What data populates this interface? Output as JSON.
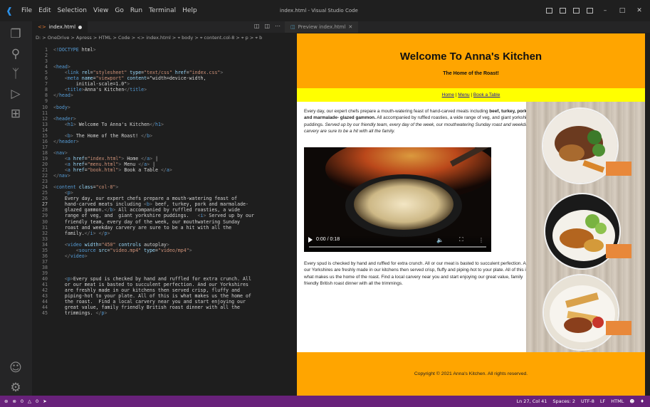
{
  "app": {
    "title": "index.html - Visual Studio Code",
    "logo": "vscode-logo"
  },
  "menu": [
    "File",
    "Edit",
    "Selection",
    "View",
    "Go",
    "Run",
    "Terminal",
    "Help"
  ],
  "activity_icons": [
    "explorer-icon",
    "search-icon",
    "source-control-icon",
    "run-debug-icon",
    "extensions-icon",
    "account-icon",
    "settings-gear-icon"
  ],
  "editor": {
    "tab_label": "index.html",
    "breadcrumb": "D: > OneDrive > Apress > HTML > Code > <> index.html > ⌖ body > ⌖ content.col-8 > ⌖ p > ⌖ b",
    "current_line": 27,
    "lines": [
      {
        "n": "1",
        "t": "<!DOCTYPE html>"
      },
      {
        "n": "2",
        "t": ""
      },
      {
        "n": "3",
        "t": ""
      },
      {
        "n": "4",
        "t": "<head>"
      },
      {
        "n": "5",
        "t": "    <link rel=\"stylesheet\" type=\"text/css\" href=\"index.css\">"
      },
      {
        "n": "6",
        "t": "    <meta name=\"viewport\" content=\"width=device-width,"
      },
      {
        "n": "7",
        "t": "        initial-scale=1.0\">"
      },
      {
        "n": "8",
        "t": "    <title>Anna's Kitchen</title>"
      },
      {
        "n": "8",
        "t": "</head>"
      },
      {
        "n": "9",
        "t": ""
      },
      {
        "n": "10",
        "t": "<body>"
      },
      {
        "n": "11",
        "t": ""
      },
      {
        "n": "12",
        "t": "<header>"
      },
      {
        "n": "13",
        "t": "    <h1> Welcome To Anna's Kitchen</h1>"
      },
      {
        "n": "14",
        "t": ""
      },
      {
        "n": "15",
        "t": "    <b> The Home of the Roast! </b>"
      },
      {
        "n": "16",
        "t": "</header>"
      },
      {
        "n": "17",
        "t": ""
      },
      {
        "n": "18",
        "t": "<nav>"
      },
      {
        "n": "19",
        "t": "    <a href=\"index.html\"> Home </a> |"
      },
      {
        "n": "20",
        "t": "    <a href=\"menu.html\"> Menu </a> |"
      },
      {
        "n": "21",
        "t": "    <a href=\"book.html\"> Book a Table </a>"
      },
      {
        "n": "22",
        "t": "</nav>"
      },
      {
        "n": "23",
        "t": ""
      },
      {
        "n": "24",
        "t": "<content class=\"col-8\">"
      },
      {
        "n": "25",
        "t": "    <p>"
      },
      {
        "n": "26",
        "t": "    Every day, our expert chefs prepare a mouth-watering feast of"
      },
      {
        "n": "27",
        "t": "    hand-carved meats including <b> beef, turkey, pork and marmalade-"
      },
      {
        "n": "28",
        "t": "    glazed gammon.</b> All accompanied by ruffled roasties, a wide"
      },
      {
        "n": "29",
        "t": "    range of veg, and  giant yorkshire puddings.   <i> Served up by our"
      },
      {
        "n": "30",
        "t": "    friendly team, every day of the week, our mouthwatering Sunday"
      },
      {
        "n": "31",
        "t": "    roast and weekday carvery are sure to be a hit with all the"
      },
      {
        "n": "32",
        "t": "    family.</i> </p>"
      },
      {
        "n": "33",
        "t": ""
      },
      {
        "n": "34",
        "t": "    <video width=\"450\" controls autoplay>"
      },
      {
        "n": "35",
        "t": "        <source src=\"video.mp4\" type=\"video/mp4\">"
      },
      {
        "n": "36",
        "t": "    </video>"
      },
      {
        "n": "37",
        "t": ""
      },
      {
        "n": "38",
        "t": ""
      },
      {
        "n": "39",
        "t": ""
      },
      {
        "n": "40",
        "t": "    <p>Every spud is checked by hand and ruffled for extra crunch. All"
      },
      {
        "n": "41",
        "t": "    or our meat is basted to succulent perfection. And our Yorkshires"
      },
      {
        "n": "42",
        "t": "    are freshly made in our kitchens then served crisp, fluffy and"
      },
      {
        "n": "43",
        "t": "    piping-hot to your plate. All of this is what makes us the home of"
      },
      {
        "n": "44",
        "t": "    the roast.  Find a local carvery near you and start enjoying our"
      },
      {
        "n": "44",
        "t": "    great value, family friendly British roast dinner with all the"
      },
      {
        "n": "45",
        "t": "    trimmings. </p>"
      }
    ]
  },
  "preview": {
    "tab_label": "Preview index.html",
    "site": {
      "h1": "Welcome To Anna's Kitchen",
      "tagline": "The Home of the Roast!",
      "nav": {
        "home": "Home",
        "menu": "Menu",
        "book": "Book a Table",
        "sep": "|"
      },
      "p1_start": "Every day, our expert chefs prepare a mouth-watering feast of hand-carved meats including ",
      "p1_bold": "beef, turkey, pork and marmalade- glazed gammon.",
      "p1_mid": " All accompanied by ruffled roasties, a wide range of veg, and giant yorkshire puddings. ",
      "p1_italic": "Served up by our friendly team, every day of the week, our mouthwatering Sunday roast and weekday carvery are sure to be a hit with all the family.",
      "video_time": "0:00 / 0:18",
      "p2": "Every spud is checked by hand and ruffled for extra crunch. All or our meat is basted to succulent perfection. And our Yorkshires are freshly made in our kitchens then served crisp, fluffy and piping-hot to your plate. All of this is what makes us the home of the roast. Find a local carvery near you and start enjoying our great value, family friendly British roast dinner with all the trimmings.",
      "footer": "Copyright © 2021 Anna's Kitchen. All rights reserved."
    }
  },
  "status": {
    "errors": "0",
    "warnings": "0",
    "position": "Ln 27, Col 41",
    "spaces": "Spaces: 2",
    "encoding": "UTF-8",
    "eol": "LF",
    "language": "HTML"
  },
  "colors": {
    "accent": "#ffa500",
    "nav_bg": "#ffff00",
    "statusbar": "#68217a"
  }
}
